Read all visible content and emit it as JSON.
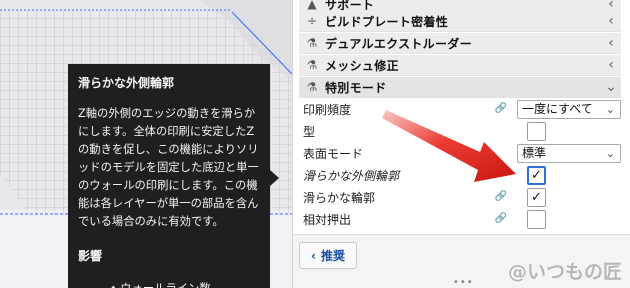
{
  "categories": [
    {
      "icon": "support-icon",
      "glyph": "▲",
      "label": "サポート"
    },
    {
      "icon": "adhesion-icon",
      "glyph": "÷",
      "label": "ビルドプレート密着性"
    },
    {
      "icon": "dual-extrusion-icon",
      "glyph": "⚗",
      "label": "デュアルエクストルーダー"
    },
    {
      "icon": "mesh-fix-icon",
      "glyph": "⚗",
      "label": "メッシュ修正"
    },
    {
      "icon": "special-modes-icon",
      "glyph": "⚗",
      "label": "特別モード"
    }
  ],
  "settings": {
    "print_sequence": {
      "label": "印刷頻度",
      "value": "一度にすべて"
    },
    "mold": {
      "label": "型"
    },
    "surface_mode": {
      "label": "表面モード",
      "value": "標準"
    },
    "smooth_outer": {
      "label": "滑らかな外側輪郭",
      "checked": "✓"
    },
    "smooth_contour": {
      "label": "滑らかな輪郭",
      "checked": "✓"
    },
    "relative_extrusion": {
      "label": "相対押出"
    }
  },
  "footer": {
    "recommended_label": "推奨",
    "grip": "•••",
    "watermark": "@いつもの匠"
  },
  "tooltip": {
    "title": "滑らかな外側輪郭",
    "body": "Z軸の外側のエッジの動きを滑らかにします。全体の印刷に安定したZの動きを促し、この機能によりソリッドのモデルを固定した底辺と単一のウォールの印刷にします。この機能は各レイヤーが単一の部品を含んでいる場合のみに有効です。",
    "heading": "影響",
    "affects": "• ウォールライン数"
  },
  "colors": {
    "arrow": "#e8261d",
    "checkbox_focus": "#2f6fd6",
    "tooltip_bg": "#1f1f1f",
    "buildplate_edge": "#3d66ff"
  }
}
